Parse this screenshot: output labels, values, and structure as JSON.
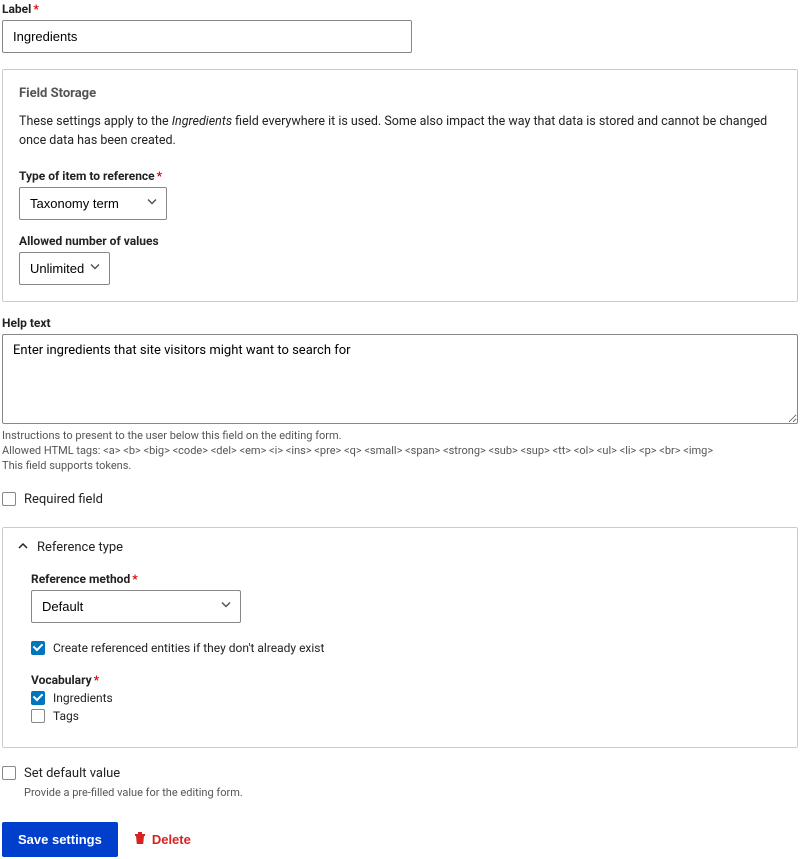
{
  "label": {
    "label": "Label",
    "value": "Ingredients"
  },
  "storage": {
    "heading": "Field Storage",
    "desc_prefix": "These settings apply to the ",
    "desc_em": "Ingredients",
    "desc_suffix": " field everywhere it is used. Some also impact the way that data is stored and cannot be changed once data has been created.",
    "type_label": "Type of item to reference",
    "type_value": "Taxonomy term",
    "allowed_label": "Allowed number of values",
    "allowed_value": "Unlimited"
  },
  "help": {
    "label": "Help text",
    "value": "Enter ingredients that site visitors might want to search for",
    "note1": "Instructions to present to the user below this field on the editing form.",
    "note2": "Allowed HTML tags: <a> <b> <big> <code> <del> <em> <i> <ins> <pre> <q> <small> <span> <strong> <sub> <sup> <tt> <ol> <ul> <li> <p> <br> <img>",
    "note3": "This field supports tokens."
  },
  "required": {
    "label": "Required field",
    "checked": false
  },
  "reference": {
    "summary": "Reference type",
    "method_label": "Reference method",
    "method_value": "Default",
    "create_label": "Create referenced entities if they don't already exist",
    "create_checked": true,
    "vocab_label": "Vocabulary",
    "vocab_options": [
      {
        "label": "Ingredients",
        "checked": true
      },
      {
        "label": "Tags",
        "checked": false
      }
    ]
  },
  "default": {
    "label": "Set default value",
    "desc": "Provide a pre-filled value for the editing form.",
    "checked": false
  },
  "actions": {
    "save": "Save settings",
    "delete": "Delete"
  }
}
